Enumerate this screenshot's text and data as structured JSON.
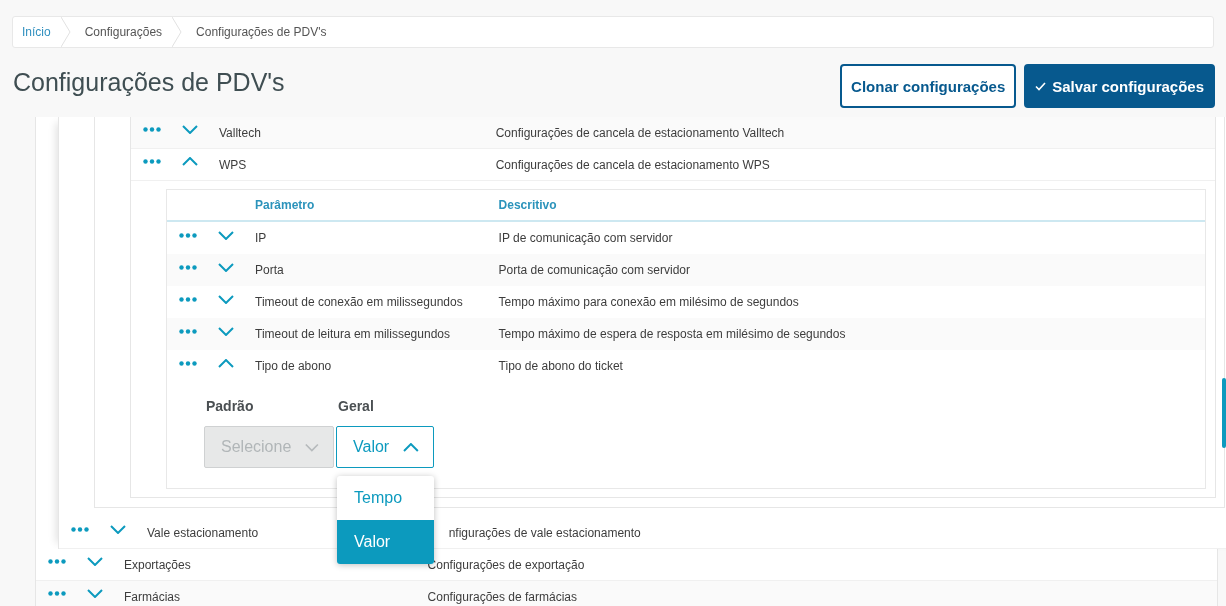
{
  "breadcrumb": [
    {
      "label": "Início",
      "link": true
    },
    {
      "label": "Configurações",
      "link": false
    },
    {
      "label": "Configurações de PDV's",
      "link": false
    }
  ],
  "title": "Configurações de PDV's",
  "actions": [
    {
      "label": "Clonar configurações",
      "kind": "outline"
    },
    {
      "label": "Salvar configurações",
      "kind": "primary"
    }
  ],
  "tree": {
    "children": [
      {
        "children": [
          {
            "children": [
              {
                "children": [
                  {
                    "name": "Valltech",
                    "description": "Configurações de cancela de estacionamento Valltech",
                    "expanded": false
                  },
                  {
                    "name": "WPS",
                    "description": "Configurações de cancela de estacionamento WPS",
                    "expanded": true,
                    "table": {
                      "columns": [
                        "Parâmetro",
                        "Descritivo"
                      ],
                      "rows": [
                        {
                          "name": "IP",
                          "description": "IP de comunicação com servidor",
                          "expanded": false
                        },
                        {
                          "name": "Porta",
                          "description": "Porta de comunicação com servidor",
                          "expanded": false
                        },
                        {
                          "name": "Timeout de conexão em milissegundos",
                          "description": "Tempo máximo para conexão em milésimo de segundos",
                          "expanded": false
                        },
                        {
                          "name": "Timeout de leitura em milissegundos",
                          "description": "Tempo máximo de espera de resposta em milésimo de segundos",
                          "expanded": false
                        },
                        {
                          "name": "Tipo de abono",
                          "description": "Tipo de abono do ticket",
                          "expanded": true,
                          "fields": [
                            {
                              "label": "Padrão",
                              "placeholder": "Selecione",
                              "disabled": true,
                              "open": false
                            },
                            {
                              "label": "Geral",
                              "value": "Valor",
                              "disabled": false,
                              "open": true,
                              "options": [
                                {
                                  "label": "Tempo",
                                  "selected": false
                                },
                                {
                                  "label": "Valor",
                                  "selected": true
                                }
                              ]
                            }
                          ]
                        }
                      ]
                    }
                  }
                ]
              }
            ]
          },
          {
            "name": "Vale estacionamento",
            "description": "nfigurações de vale estacionamento",
            "expanded": false
          }
        ]
      },
      {
        "name": "Exportações",
        "description": "Configurações de exportação",
        "expanded": false
      },
      {
        "name": "Farmácias",
        "description": "Configurações de farmácias",
        "expanded": false
      }
    ]
  }
}
